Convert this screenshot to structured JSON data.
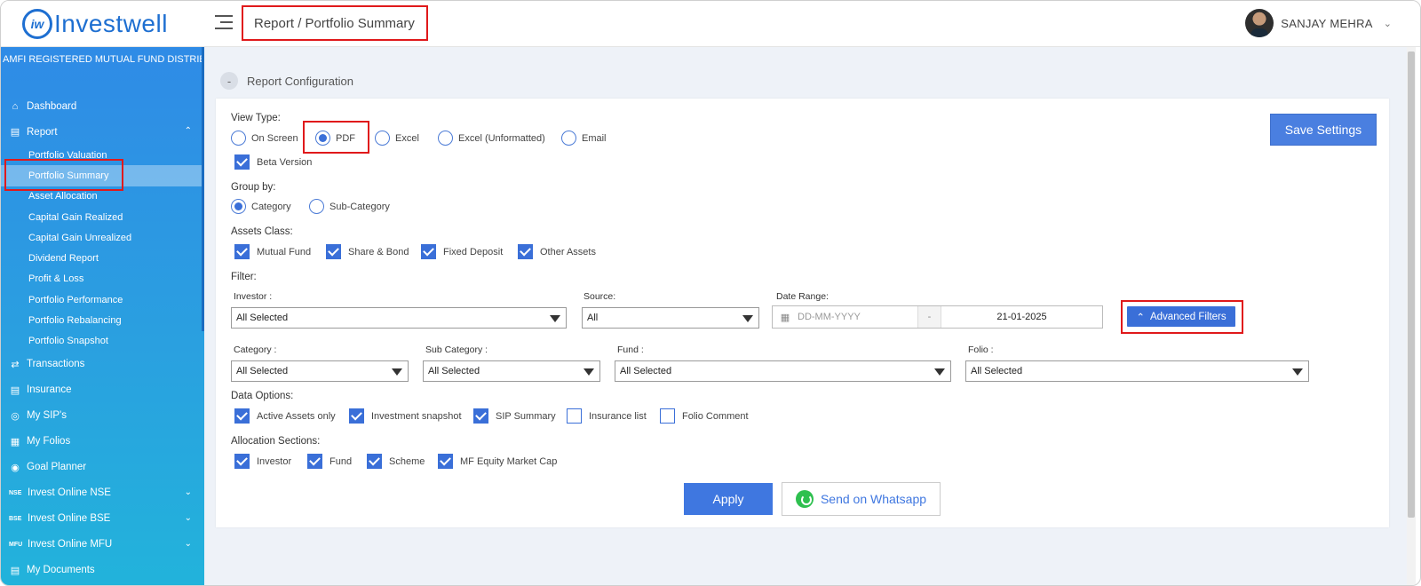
{
  "header": {
    "logo_mark": "iw",
    "logo_text": "Investwell",
    "breadcrumb": "Report / Portfolio Summary",
    "user_name": "SANJAY MEHRA"
  },
  "sidebar": {
    "amfi": "AMFI REGISTERED MUTUAL FUND DISTRIBUTOR",
    "items": [
      {
        "label": "Dashboard"
      },
      {
        "label": "Report"
      },
      {
        "label": "Transactions"
      },
      {
        "label": "Insurance"
      },
      {
        "label": "My SIP's"
      },
      {
        "label": "My Folios"
      },
      {
        "label": "Goal Planner"
      },
      {
        "label": "Invest Online NSE",
        "tag": "NSE"
      },
      {
        "label": "Invest Online BSE",
        "tag": "BSE"
      },
      {
        "label": "Invest Online MFU",
        "tag": "MFU"
      },
      {
        "label": "My Documents"
      }
    ],
    "report_sub": [
      "Portfolio Valuation",
      "Portfolio Summary",
      "Asset Allocation",
      "Capital Gain Realized",
      "Capital Gain Unrealized",
      "Dividend Report",
      "Profit & Loss",
      "Portfolio Performance",
      "Portfolio Rebalancing",
      "Portfolio Snapshot"
    ]
  },
  "report_config": {
    "toggle": "-",
    "title": "Report Configuration",
    "save_settings": "Save Settings",
    "view_type": {
      "label": "View Type:",
      "options": [
        "On Screen",
        "PDF",
        "Excel",
        "Excel (Unformatted)",
        "Email"
      ],
      "selected": "PDF",
      "beta_label": "Beta Version",
      "beta_checked": true
    },
    "group_by": {
      "label": "Group by:",
      "options": [
        "Category",
        "Sub-Category"
      ],
      "selected": "Category"
    },
    "assets_class": {
      "label": "Assets Class:",
      "options": [
        "Mutual Fund",
        "Share & Bond",
        "Fixed Deposit",
        "Other Assets"
      ]
    },
    "filter": {
      "label": "Filter:",
      "investor_label": "Investor :",
      "investor_value": "All Selected",
      "source_label": "Source:",
      "source_value": "All",
      "date_range_label": "Date Range:",
      "date_from_placeholder": "DD-MM-YYYY",
      "date_sep": "-",
      "date_to": "21-01-2025",
      "advanced_filters": "Advanced Filters",
      "category_label": "Category :",
      "category_value": "All Selected",
      "subcategory_label": "Sub Category :",
      "subcategory_value": "All Selected",
      "fund_label": "Fund :",
      "fund_value": "All Selected",
      "folio_label": "Folio :",
      "folio_value": "All Selected"
    },
    "data_options": {
      "label": "Data Options:",
      "options": [
        {
          "label": "Active Assets only",
          "checked": true
        },
        {
          "label": "Investment snapshot",
          "checked": true
        },
        {
          "label": "SIP Summary",
          "checked": true
        },
        {
          "label": "Insurance list",
          "checked": false
        },
        {
          "label": "Folio Comment",
          "checked": false
        }
      ]
    },
    "allocation": {
      "label": "Allocation Sections:",
      "options": [
        "Investor",
        "Fund",
        "Scheme",
        "MF Equity Market Cap"
      ]
    },
    "apply": "Apply",
    "send_whatsapp": "Send on Whatsapp"
  },
  "colors": {
    "brand": "#1e6fd1",
    "primary_button": "#3f77e0",
    "highlight": "#e0191b"
  }
}
